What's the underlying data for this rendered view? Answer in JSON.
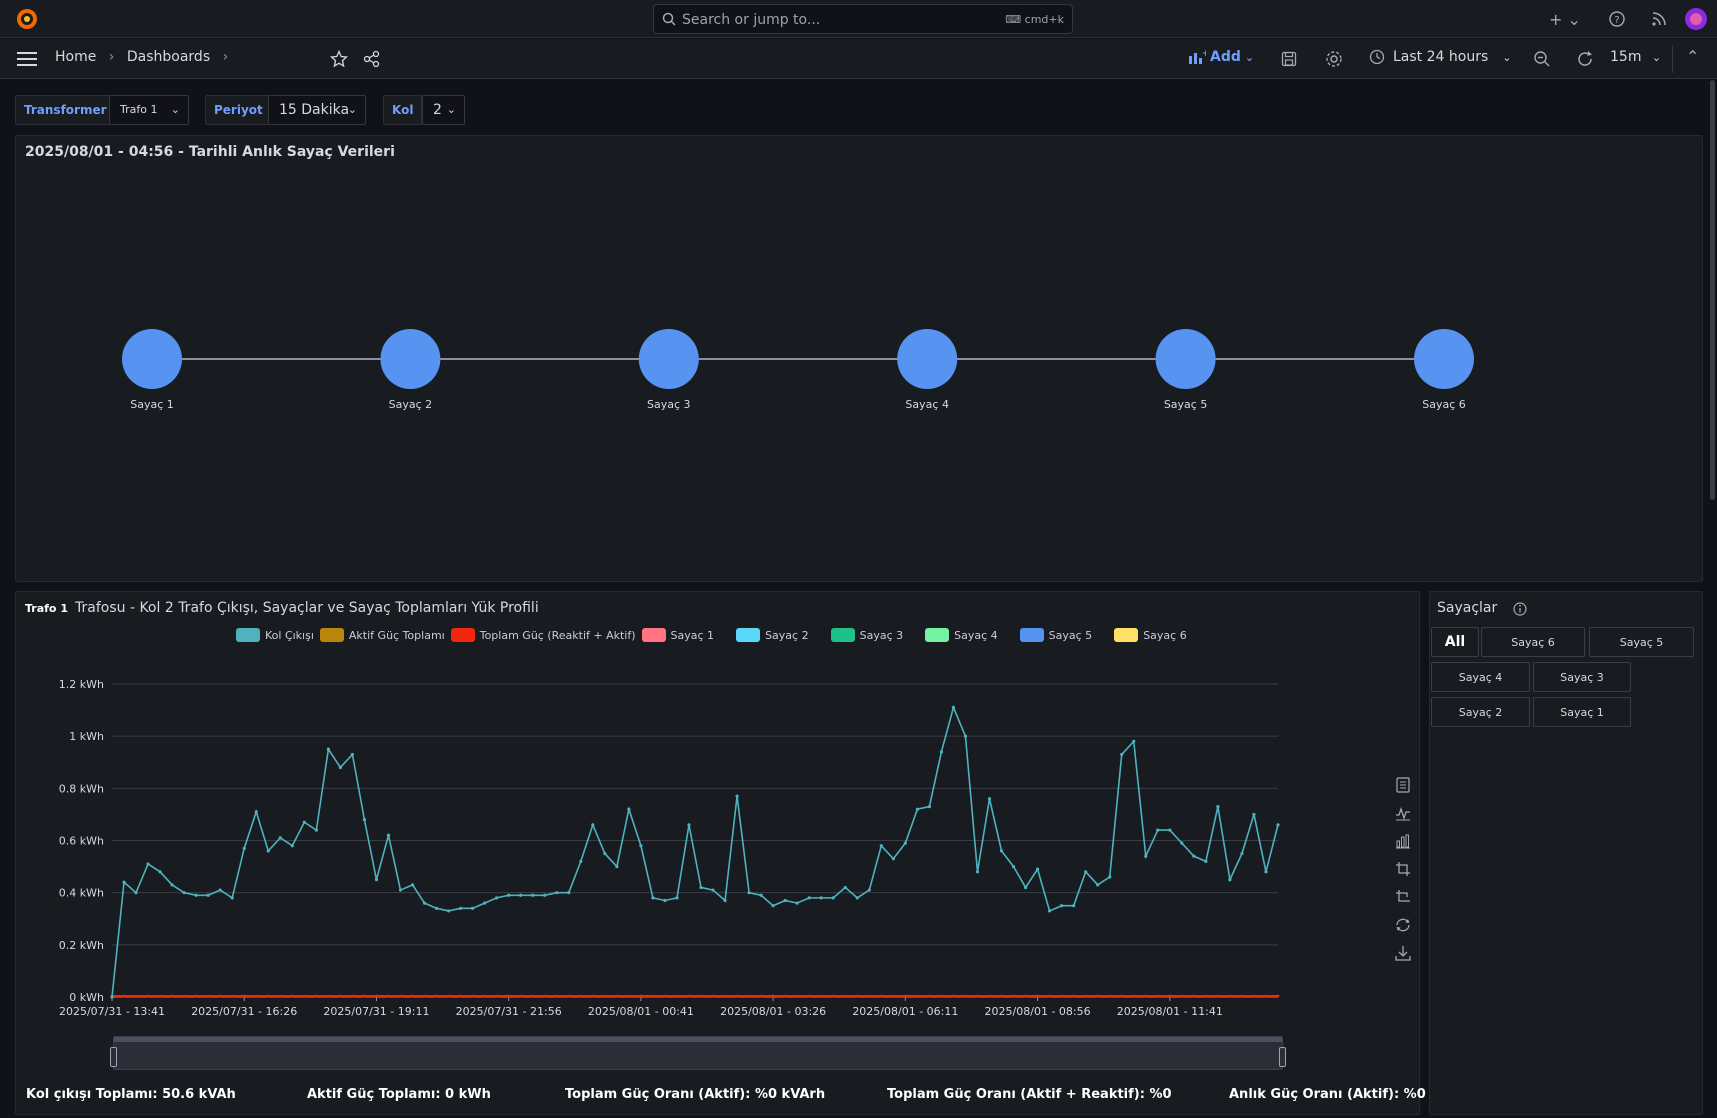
{
  "search": {
    "placeholder": "Search or jump to...",
    "shortcut": "cmd+k"
  },
  "breadcrumb": {
    "home": "Home",
    "dashboards": "Dashboards"
  },
  "toolbar": {
    "add_label": "Add",
    "time_range": "Last 24 hours",
    "refresh_interval": "15m"
  },
  "variables": {
    "transformer": {
      "label": "Transformer",
      "value": "Trafo 1"
    },
    "periyot": {
      "label": "Periyot",
      "value": "15 Dakika"
    },
    "kol": {
      "label": "Kol",
      "value": "2"
    }
  },
  "topology_panel": {
    "title": "2025/08/01 - 04:56 - Tarihli Anlık Sayaç Verileri",
    "nodes": [
      "Sayaç 1",
      "Sayaç 2",
      "Sayaç 3",
      "Sayaç 4",
      "Sayaç 5",
      "Sayaç 6"
    ],
    "node_color": "#5794f2"
  },
  "chart_panel": {
    "title_badge": "Trafo 1",
    "title": "Trafosu - Kol 2 Trafo Çıkışı, Sayaçlar ve Sayaç Toplamları Yük Profili",
    "stats": [
      "Kol çıkışı Toplamı: 50.6 kVAh",
      "Aktif Güç Toplamı: 0 kWh",
      "Toplam Güç Oranı (Aktif): %0 kVArh",
      "Toplam Güç Oranı (Aktif + Reaktif): %0",
      "Anlık Güç Oranı (Aktif): %0"
    ]
  },
  "chart_data": {
    "type": "line",
    "ylim": [
      0,
      1.2
    ],
    "y_ticks": [
      "0 kWh",
      "0.2 kWh",
      "0.4 kWh",
      "0.6 kWh",
      "0.8 kWh",
      "1 kWh",
      "1.2 kWh"
    ],
    "x_tick_labels": [
      "2025/07/31 - 13:41",
      "2025/07/31 - 16:26",
      "2025/07/31 - 19:11",
      "2025/07/31 - 21:56",
      "2025/08/01 - 00:41",
      "2025/08/01 - 03:26",
      "2025/08/01 - 06:11",
      "2025/08/01 - 08:56",
      "2025/08/01 - 11:41"
    ],
    "legend": [
      {
        "name": "Kol Çıkışı",
        "color": "#4fb3bf"
      },
      {
        "name": "Aktif Güç Toplamı",
        "color": "#b8860b"
      },
      {
        "name": "Toplam Güç (Reaktif + Aktif)",
        "color": "#f2260f"
      },
      {
        "name": "Sayaç 1",
        "color": "#ff7383"
      },
      {
        "name": "Sayaç 2",
        "color": "#5ad8fa"
      },
      {
        "name": "Sayaç 3",
        "color": "#1ec18a"
      },
      {
        "name": "Sayaç 4",
        "color": "#73f2a0"
      },
      {
        "name": "Sayaç 5",
        "color": "#5794f2"
      },
      {
        "name": "Sayaç 6",
        "color": "#ffe066"
      }
    ],
    "series": [
      {
        "name": "Kol Çıkışı",
        "values": [
          0,
          0.44,
          0.4,
          0.51,
          0.48,
          0.43,
          0.4,
          0.39,
          0.39,
          0.41,
          0.38,
          0.57,
          0.71,
          0.56,
          0.61,
          0.58,
          0.67,
          0.64,
          0.95,
          0.88,
          0.93,
          0.68,
          0.45,
          0.62,
          0.41,
          0.43,
          0.36,
          0.34,
          0.33,
          0.34,
          0.34,
          0.36,
          0.38,
          0.39,
          0.39,
          0.39,
          0.39,
          0.4,
          0.4,
          0.52,
          0.66,
          0.55,
          0.5,
          0.72,
          0.58,
          0.38,
          0.37,
          0.38,
          0.66,
          0.42,
          0.41,
          0.37,
          0.77,
          0.4,
          0.39,
          0.35,
          0.37,
          0.36,
          0.38,
          0.38,
          0.38,
          0.42,
          0.38,
          0.41,
          0.58,
          0.53,
          0.59,
          0.72,
          0.73,
          0.94,
          1.11,
          1.0,
          0.48,
          0.76,
          0.56,
          0.5,
          0.42,
          0.49,
          0.33,
          0.35,
          0.35,
          0.48,
          0.43,
          0.46,
          0.93,
          0.98,
          0.54,
          0.64,
          0.64,
          0.59,
          0.54,
          0.52,
          0.73,
          0.45,
          0.55,
          0.7,
          0.48,
          0.66
        ]
      },
      {
        "name": "Toplam Güç (Reaktif + Aktif)",
        "values": "all 0"
      }
    ]
  },
  "meters_panel": {
    "title": "Sayaçlar",
    "buttons": [
      "All",
      "Sayaç 6",
      "Sayaç 5",
      "Sayaç 4",
      "Sayaç 3",
      "Sayaç 2",
      "Sayaç 1"
    ]
  }
}
